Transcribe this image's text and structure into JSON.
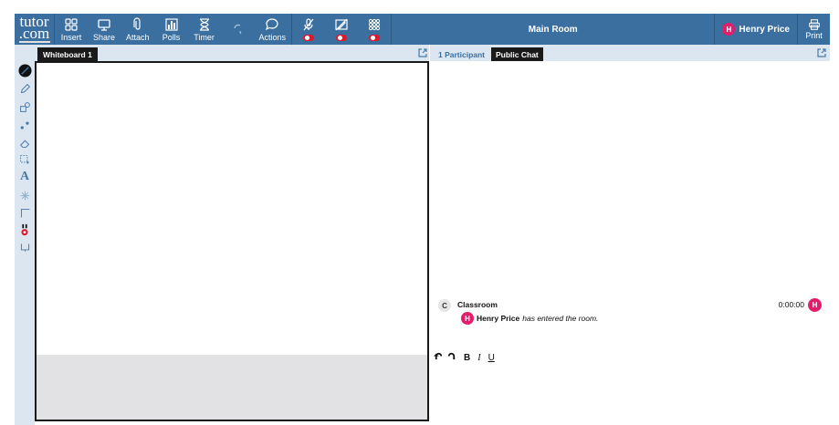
{
  "topbar": {
    "logo": "tutor\n.com",
    "logo_top": "tutor",
    "logo_bottom": ".com",
    "tools": [
      {
        "label": "Insert",
        "icon": "insert-icon"
      },
      {
        "label": "Share",
        "icon": "share-screen-icon"
      },
      {
        "label": "Attach",
        "icon": "paperclip-icon"
      },
      {
        "label": "Polls",
        "icon": "poll-chart-icon"
      },
      {
        "label": "Timer",
        "icon": "hourglass-icon"
      },
      {
        "label": "",
        "icon": "undo-icon"
      },
      {
        "label": "Actions",
        "icon": "speech-bubble-icon"
      }
    ],
    "toggles": [
      {
        "icon": "microphone-off-icon",
        "state": "off"
      },
      {
        "icon": "pencil-off-icon",
        "state": "off"
      },
      {
        "icon": "grid-icon",
        "state": "off"
      }
    ],
    "room_title": "Main Room",
    "user": {
      "initial": "H",
      "name": "Henry Price"
    },
    "print_label": "Print"
  },
  "whiteboard": {
    "tab_label": "Whiteboard 1",
    "tools": [
      "pen-icon",
      "pencil-icon",
      "shapes-icon",
      "dots-icon",
      "eraser-icon",
      "select-icon",
      "text-icon",
      "laser-icon",
      "line-icon",
      "color-icon",
      "more-icon"
    ]
  },
  "chat": {
    "participants_tab": "1 Participant",
    "public_chat_tab": "Public Chat",
    "message": {
      "sender_initial": "C",
      "sender": "Classroom",
      "time": "0:00:00",
      "user_initial": "H",
      "user_name": "Henry Price",
      "text": "has entered the room."
    },
    "right_avatar_initial": "H",
    "format": {
      "bold": "B",
      "italic": "I",
      "underline": "U"
    }
  },
  "colors": {
    "topbar": "#3a6f9f",
    "strip": "#dbe6f1",
    "avatar": "#e41d6b",
    "toggle": "#e0182d"
  }
}
